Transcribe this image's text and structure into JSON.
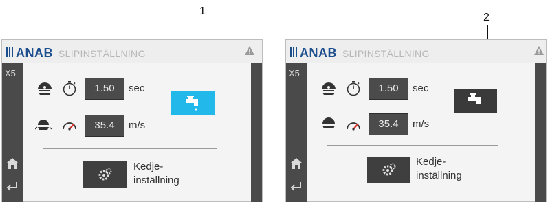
{
  "callouts": [
    "1",
    "2"
  ],
  "screens": [
    {
      "logo": "ANAB",
      "title": "SLIPINSTÄLLNING",
      "sidebar_label": "X5",
      "time": {
        "value": "1.50",
        "unit": "sec"
      },
      "speed": {
        "value": "35.4",
        "unit": "m/s"
      },
      "chain_label_line1": "Kedje-",
      "chain_label_line2": "inställning",
      "tap_state": "active"
    },
    {
      "logo": "ANAB",
      "title": "SLIPINSTÄLLNING",
      "sidebar_label": "X5",
      "time": {
        "value": "1.50",
        "unit": "sec"
      },
      "speed": {
        "value": "35.4",
        "unit": "m/s"
      },
      "chain_label_line1": "Kedje-",
      "chain_label_line2": "inställning",
      "tap_state": "inactive"
    }
  ],
  "colors": {
    "brand": "#1d4f8f",
    "tap_active": "#22b9ea",
    "tap_inactive": "#3a3a3a",
    "sidebar": "#4a4a4a",
    "value_box": "#4b4b4b",
    "warning": "#9a9a9a"
  },
  "icons": [
    "warning-icon",
    "home-icon",
    "back-icon",
    "grinding-wheel-icon",
    "stopwatch-icon",
    "wheel-speed-icon",
    "speedometer-icon",
    "water-tap-icon",
    "gears-icon"
  ]
}
